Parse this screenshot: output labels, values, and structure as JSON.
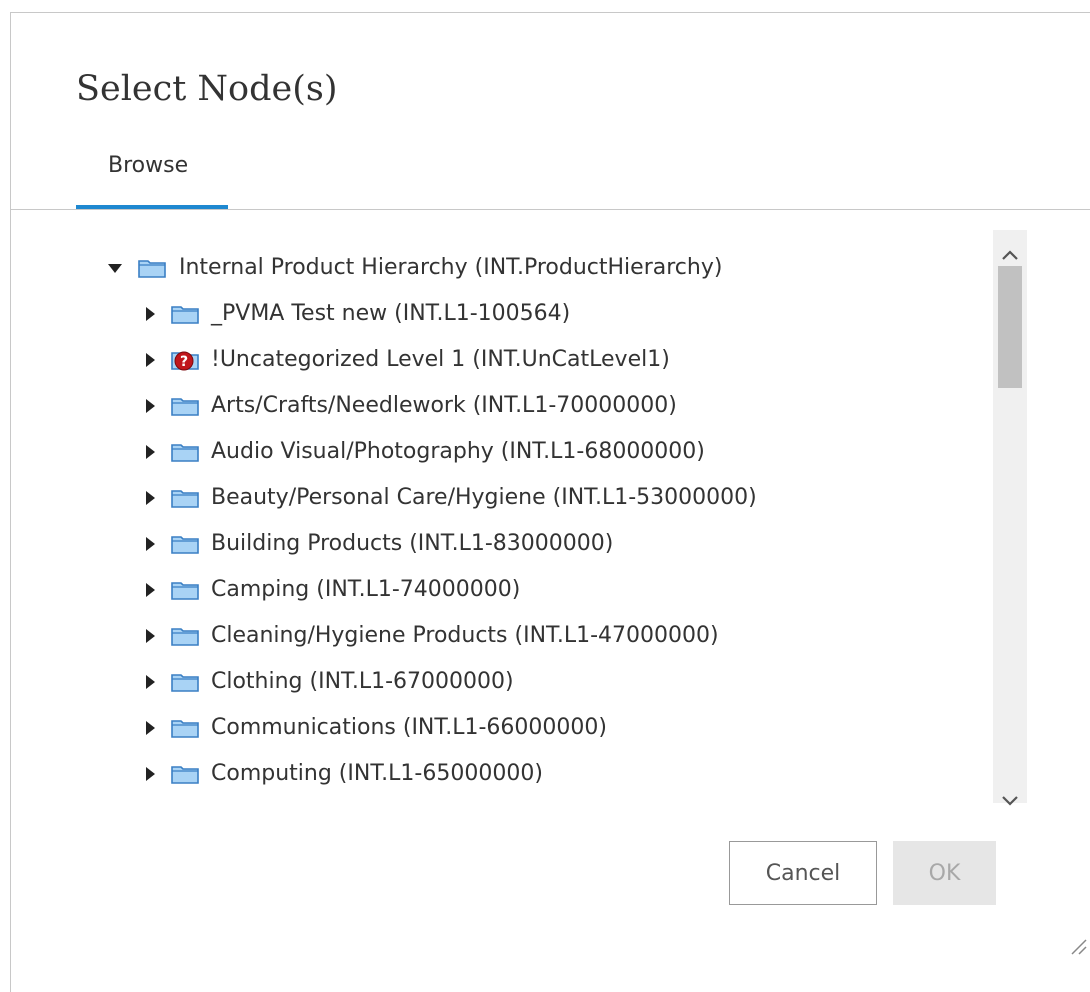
{
  "dialog": {
    "title": "Select Node(s)",
    "tabs": [
      {
        "label": "Browse",
        "active": true
      }
    ]
  },
  "tree": {
    "root": {
      "label": "Internal Product Hierarchy (INT.ProductHierarchy)",
      "expanded": true,
      "icon": "folder-icon"
    },
    "children": [
      {
        "label": "_PVMA Test new (INT.L1-100564)",
        "icon": "folder-icon"
      },
      {
        "label": "!Uncategorized Level 1 (INT.UnCatLevel1)",
        "icon": "folder-warning-icon"
      },
      {
        "label": "Arts/Crafts/Needlework (INT.L1-70000000)",
        "icon": "folder-icon"
      },
      {
        "label": "Audio Visual/Photography (INT.L1-68000000)",
        "icon": "folder-icon"
      },
      {
        "label": "Beauty/Personal Care/Hygiene (INT.L1-53000000)",
        "icon": "folder-icon"
      },
      {
        "label": "Building Products (INT.L1-83000000)",
        "icon": "folder-icon"
      },
      {
        "label": "Camping (INT.L1-74000000)",
        "icon": "folder-icon"
      },
      {
        "label": "Cleaning/Hygiene Products (INT.L1-47000000)",
        "icon": "folder-icon"
      },
      {
        "label": "Clothing (INT.L1-67000000)",
        "icon": "folder-icon"
      },
      {
        "label": "Communications (INT.L1-66000000)",
        "icon": "folder-icon"
      },
      {
        "label": "Computing (INT.L1-65000000)",
        "icon": "folder-icon"
      }
    ]
  },
  "buttons": {
    "cancel_label": "Cancel",
    "ok_label": "OK",
    "ok_disabled": true
  },
  "colors": {
    "tab_accent": "#1e88d0",
    "folder_fill": "#a9d3f5",
    "folder_stroke": "#3a7fc4",
    "warning_red": "#c0161c",
    "ok_disabled_bg": "#e6e6e6"
  }
}
